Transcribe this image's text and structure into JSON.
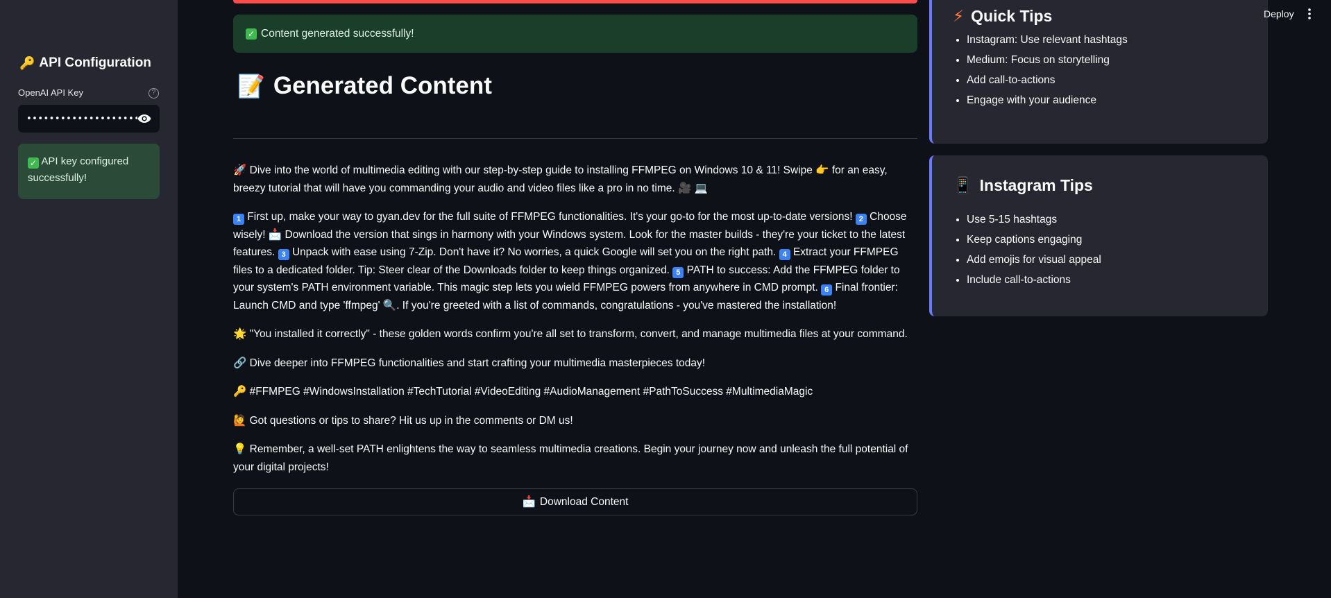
{
  "sidebar": {
    "title": "API Configuration",
    "title_icon": "key-icon",
    "api_key_label": "OpenAI API Key",
    "api_key_value": "••••••••••••••••••••••••••••",
    "success_message": "API key configured successfully!"
  },
  "main": {
    "success_message": "Content generated successfully!",
    "title": "Generated Content",
    "title_icon": "memo-icon",
    "download_label": "Download Content"
  },
  "content": {
    "p1": {
      "a": "Dive into the world of multimedia editing with our step-by-step guide to installing FFMPEG on Windows 10 & 11! Swipe ",
      "b": " for an easy, breezy tutorial that will have you commanding your audio and video files like a pro in no time. "
    },
    "p2": {
      "s1": "First up, make your way to gyan.dev for the full suite of FFMPEG functionalities. It's your go-to for the most up-to-date versions! ",
      "s2": "Choose wisely! ",
      "s2b": " Download the version that sings in harmony with your Windows system. Look for the master builds - they're your ticket to the latest features. ",
      "s3": "Unpack with ease using 7-Zip. Don't have it? No worries, a quick Google will set you on the right path. ",
      "s4": "Extract your FFMPEG files to a dedicated folder. Tip: Steer clear of the Downloads folder to keep things organized. ",
      "s5": "PATH to success: Add the FFMPEG folder to your system's PATH environment variable. This magic step lets you wield FFMPEG powers from anywhere in CMD prompt. ",
      "s6": "Final frontier: Launch CMD and type 'ffmpeg' ",
      "s6b": ". If you're greeted with a list of commands, congratulations - you've mastered the installation!"
    },
    "p3": "\"You installed it correctly\" - these golden words confirm you're all set to transform, convert, and manage multimedia files at your command.",
    "p4": "Dive deeper into FFMPEG functionalities and start crafting your multimedia masterpieces today!",
    "p5": "#FFMPEG #WindowsInstallation #TechTutorial #VideoEditing #AudioManagement #PathToSuccess #MultimediaMagic",
    "p6": "Got questions or tips to share? Hit us up in the comments or DM us!",
    "p7": "Remember, a well-set PATH enlightens the way to seamless multimedia creations. Begin your journey now and unleash the full potential of your digital projects!",
    "numbers": [
      "1",
      "2",
      "3",
      "4",
      "5",
      "6"
    ]
  },
  "quick_tips": {
    "title": "Quick Tips",
    "items": [
      "Instagram: Use relevant hashtags",
      "Medium: Focus on storytelling",
      "Add call-to-actions",
      "Engage with your audience"
    ]
  },
  "instagram_tips": {
    "title": "Instagram Tips",
    "items": [
      "Use 5-15 hashtags",
      "Keep captions engaging",
      "Add emojis for visual appeal",
      "Include call-to-actions"
    ]
  },
  "header": {
    "deploy_label": "Deploy"
  },
  "colors": {
    "accent_border": "#6a7bff",
    "error_bar": "#ff4b4b",
    "success_bg": "#1b3e2b"
  }
}
